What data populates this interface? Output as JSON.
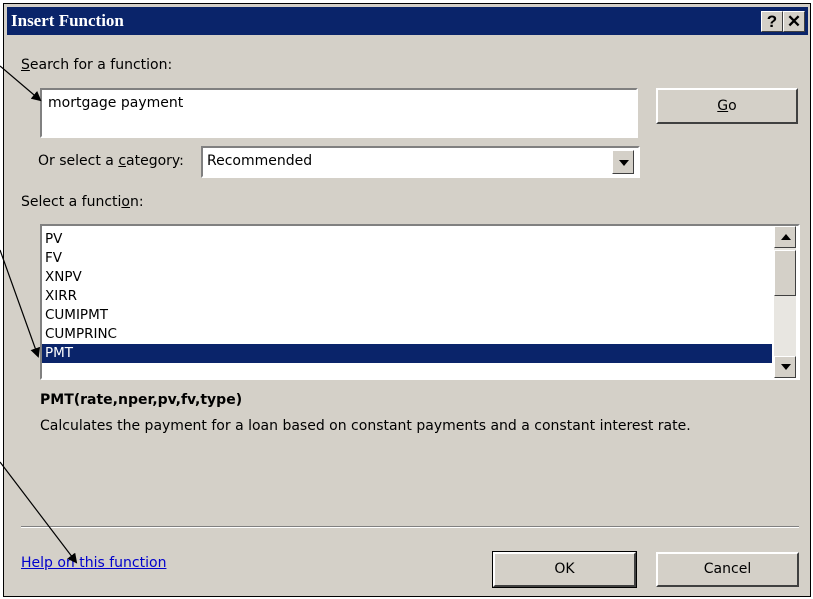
{
  "dialog": {
    "title": "Insert Function",
    "help_glyph": "?",
    "close_glyph": "✕"
  },
  "search": {
    "label": "Search for a function:",
    "value": "mortgage payment",
    "go_label": "Go"
  },
  "category": {
    "label": "Or select a category:",
    "selected": "Recommended"
  },
  "functions": {
    "label": "Select a function:",
    "items": [
      "PV",
      "FV",
      "XNPV",
      "XIRR",
      "CUMIPMT",
      "CUMPRINC",
      "PMT"
    ],
    "selected": "PMT"
  },
  "detail": {
    "signature": "PMT(rate,nper,pv,fv,type)",
    "description": "Calculates the payment for a loan based on constant payments and a constant interest rate."
  },
  "footer": {
    "help_link": "Help on this function",
    "ok_label": "OK",
    "cancel_label": "Cancel"
  },
  "colors": {
    "title_bar": "#0a246a",
    "dialog_face": "#d4d0c8",
    "selection": "#0a246a",
    "link": "#0000cc"
  }
}
